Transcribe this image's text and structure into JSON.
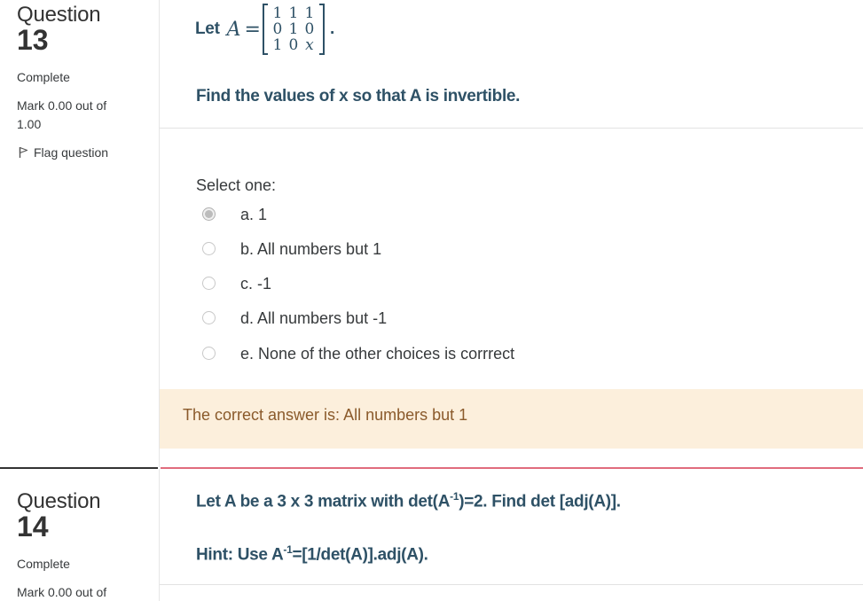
{
  "question13": {
    "word": "Question",
    "number": "13",
    "state": "Complete",
    "mark": "Mark 0.00 out of",
    "mark_max": "1.00",
    "flag_label": "Flag question",
    "let_text": "Let",
    "matrix_symbol": "A",
    "equals": "=",
    "matrix": [
      [
        "1",
        "1",
        "1"
      ],
      [
        "0",
        "1",
        "0"
      ],
      [
        "1",
        "0",
        "x"
      ]
    ],
    "matrix_end": ".",
    "prompt": "Find the values of x so that A is invertible.",
    "select_one": "Select one:",
    "options": [
      {
        "label": "a. 1",
        "checked": true
      },
      {
        "label": "b. All numbers but 1",
        "checked": false
      },
      {
        "label": "c. -1",
        "checked": false
      },
      {
        "label": "d. All numbers but -1",
        "checked": false
      },
      {
        "label": "e. None of the other choices is corrrect",
        "checked": false
      }
    ],
    "feedback": "The correct answer is: All numbers but 1"
  },
  "question14": {
    "word": "Question",
    "number": "14",
    "state": "Complete",
    "mark": "Mark 0.00 out of",
    "prompt_pre": "Let A be a 3 x 3 matrix with det(A",
    "prompt_sup": "-1",
    "prompt_post": ")=2. Find det [adj(A)].",
    "hint_pre": "Hint: Use A",
    "hint_sup": "-1",
    "hint_post": "=[1/det(A)].adj(A)."
  },
  "colors": {
    "question_text": "#2e5166",
    "feedback_bg": "#fcefdc",
    "feedback_text": "#8a5a2b",
    "divider_accent": "#e06c7d"
  }
}
